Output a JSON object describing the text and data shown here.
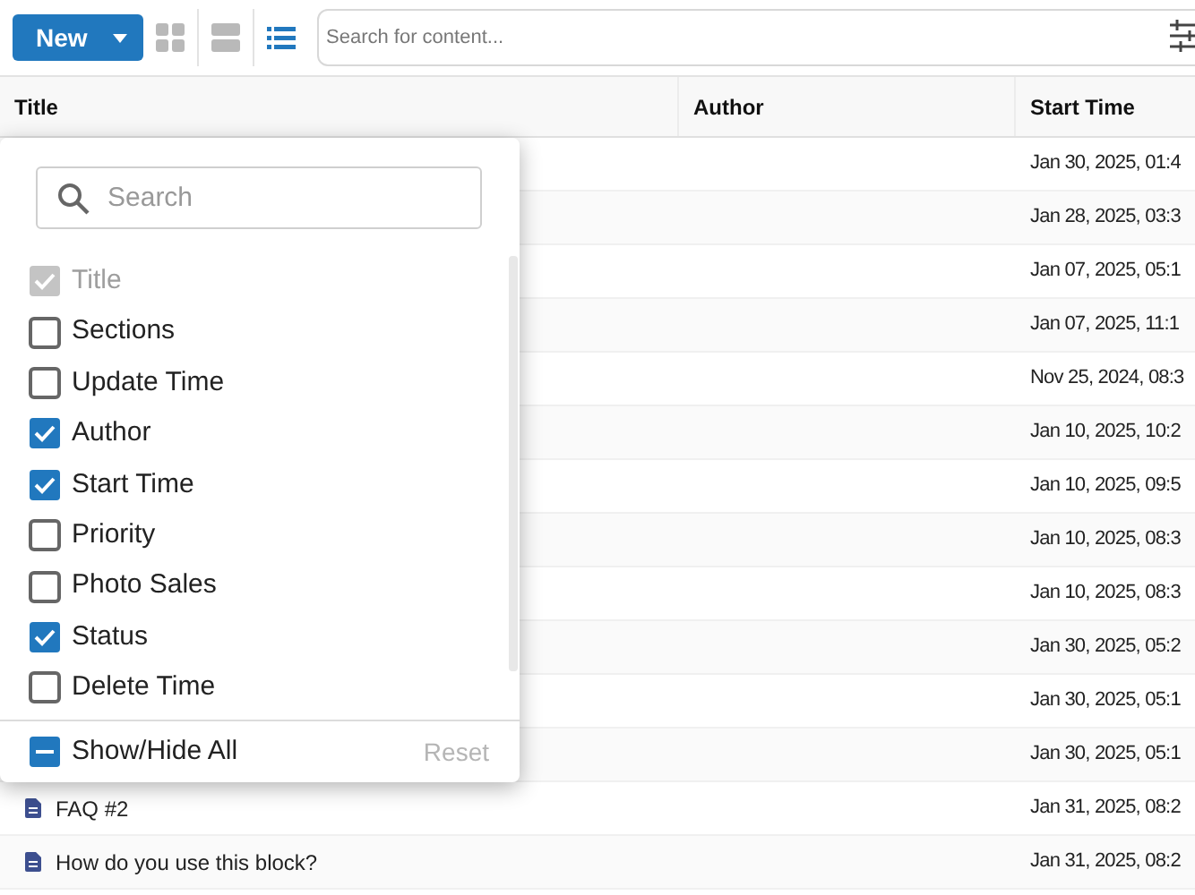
{
  "toolbar": {
    "new_button": "New",
    "views": [
      {
        "kind": "grid",
        "selected": false
      },
      {
        "kind": "rows",
        "selected": false
      },
      {
        "kind": "list",
        "selected": true
      }
    ],
    "search": {
      "placeholder": "Search for content..."
    }
  },
  "table": {
    "columns": [
      "Title",
      "Author",
      "Start Time"
    ],
    "rows": [
      {
        "start_time": "Jan 30, 2025, 01:4"
      },
      {
        "start_time": "Jan 28, 2025, 03:3"
      },
      {
        "start_time": "Jan 07, 2025, 05:1"
      },
      {
        "start_time": "Jan 07, 2025, 11:1"
      },
      {
        "start_time": "Nov 25, 2024, 08:3"
      },
      {
        "start_time": "Jan 10, 2025, 10:2"
      },
      {
        "start_time": "Jan 10, 2025, 09:5"
      },
      {
        "start_time": "Jan 10, 2025, 08:3"
      },
      {
        "start_time": "Jan 10, 2025, 08:3"
      },
      {
        "start_time": "Jan 30, 2025, 05:2"
      },
      {
        "start_time": "Jan 30, 2025, 05:1"
      },
      {
        "start_time": "Jan 30, 2025, 05:1"
      },
      {
        "title": "FAQ #2",
        "start_time": "Jan 31, 2025, 08:2"
      },
      {
        "title": "How do you use this block?",
        "start_time": "Jan 31, 2025, 08:2"
      }
    ]
  },
  "column_menu": {
    "search": {
      "placeholder": "Search"
    },
    "items": [
      {
        "label": "Title",
        "checked": true,
        "disabled": true
      },
      {
        "label": "Sections",
        "checked": false,
        "disabled": false
      },
      {
        "label": "Update Time",
        "checked": false,
        "disabled": false
      },
      {
        "label": "Author",
        "checked": true,
        "disabled": false
      },
      {
        "label": "Start Time",
        "checked": true,
        "disabled": false
      },
      {
        "label": "Priority",
        "checked": false,
        "disabled": false
      },
      {
        "label": "Photo Sales",
        "checked": false,
        "disabled": false
      },
      {
        "label": "Status",
        "checked": true,
        "disabled": false
      },
      {
        "label": "Delete Time",
        "checked": false,
        "disabled": false
      }
    ],
    "show_hide_all": {
      "label": "Show/Hide All",
      "indeterminate": true
    },
    "reset": {
      "label": "Reset",
      "disabled": true
    }
  }
}
